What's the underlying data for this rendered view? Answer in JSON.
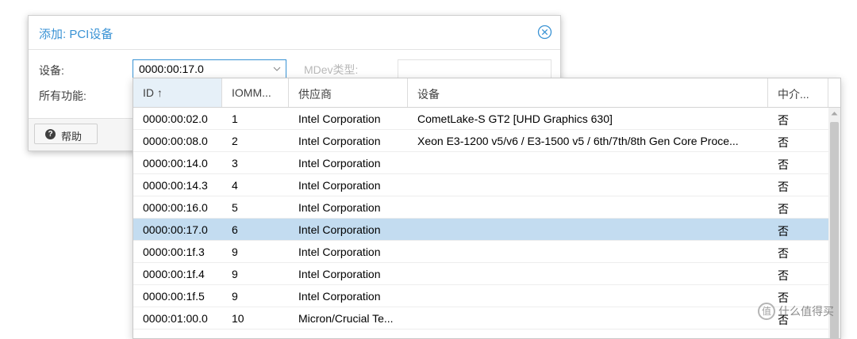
{
  "dialog": {
    "title": "添加: PCI设备",
    "device_label": "设备:",
    "device_value": "0000:00:17.0",
    "mdev_label": "MDev类型:",
    "mdev_value": "",
    "all_functions_label": "所有功能:",
    "help_label": "帮助",
    "help_icon_glyph": "?"
  },
  "grid": {
    "columns": [
      {
        "label": "ID ↑",
        "sorted": true
      },
      {
        "label": "IOMM..."
      },
      {
        "label": "供应商"
      },
      {
        "label": "设备"
      },
      {
        "label": "中介..."
      }
    ],
    "rows": [
      {
        "id": "0000:00:02.0",
        "iommu": "1",
        "vendor": "Intel Corporation",
        "device": "CometLake-S GT2 [UHD Graphics 630]",
        "mediated": "否"
      },
      {
        "id": "0000:00:08.0",
        "iommu": "2",
        "vendor": "Intel Corporation",
        "device": "Xeon E3-1200 v5/v6 / E3-1500 v5 / 6th/7th/8th Gen Core Proce...",
        "mediated": "否"
      },
      {
        "id": "0000:00:14.0",
        "iommu": "3",
        "vendor": "Intel Corporation",
        "device": "",
        "mediated": "否"
      },
      {
        "id": "0000:00:14.3",
        "iommu": "4",
        "vendor": "Intel Corporation",
        "device": "",
        "mediated": "否"
      },
      {
        "id": "0000:00:16.0",
        "iommu": "5",
        "vendor": "Intel Corporation",
        "device": "",
        "mediated": "否"
      },
      {
        "id": "0000:00:17.0",
        "iommu": "6",
        "vendor": "Intel Corporation",
        "device": "",
        "mediated": "否",
        "selected": true
      },
      {
        "id": "0000:00:1f.3",
        "iommu": "9",
        "vendor": "Intel Corporation",
        "device": "",
        "mediated": "否"
      },
      {
        "id": "0000:00:1f.4",
        "iommu": "9",
        "vendor": "Intel Corporation",
        "device": "",
        "mediated": "否"
      },
      {
        "id": "0000:00:1f.5",
        "iommu": "9",
        "vendor": "Intel Corporation",
        "device": "",
        "mediated": "否"
      },
      {
        "id": "0000:01:00.0",
        "iommu": "10",
        "vendor": "Micron/Crucial Te...",
        "device": "",
        "mediated": "否"
      }
    ]
  },
  "watermark": {
    "text": "什么值得买",
    "icon_glyph": "值"
  },
  "colors": {
    "accent": "#3892d4",
    "selected_row": "#c3dcf0"
  }
}
